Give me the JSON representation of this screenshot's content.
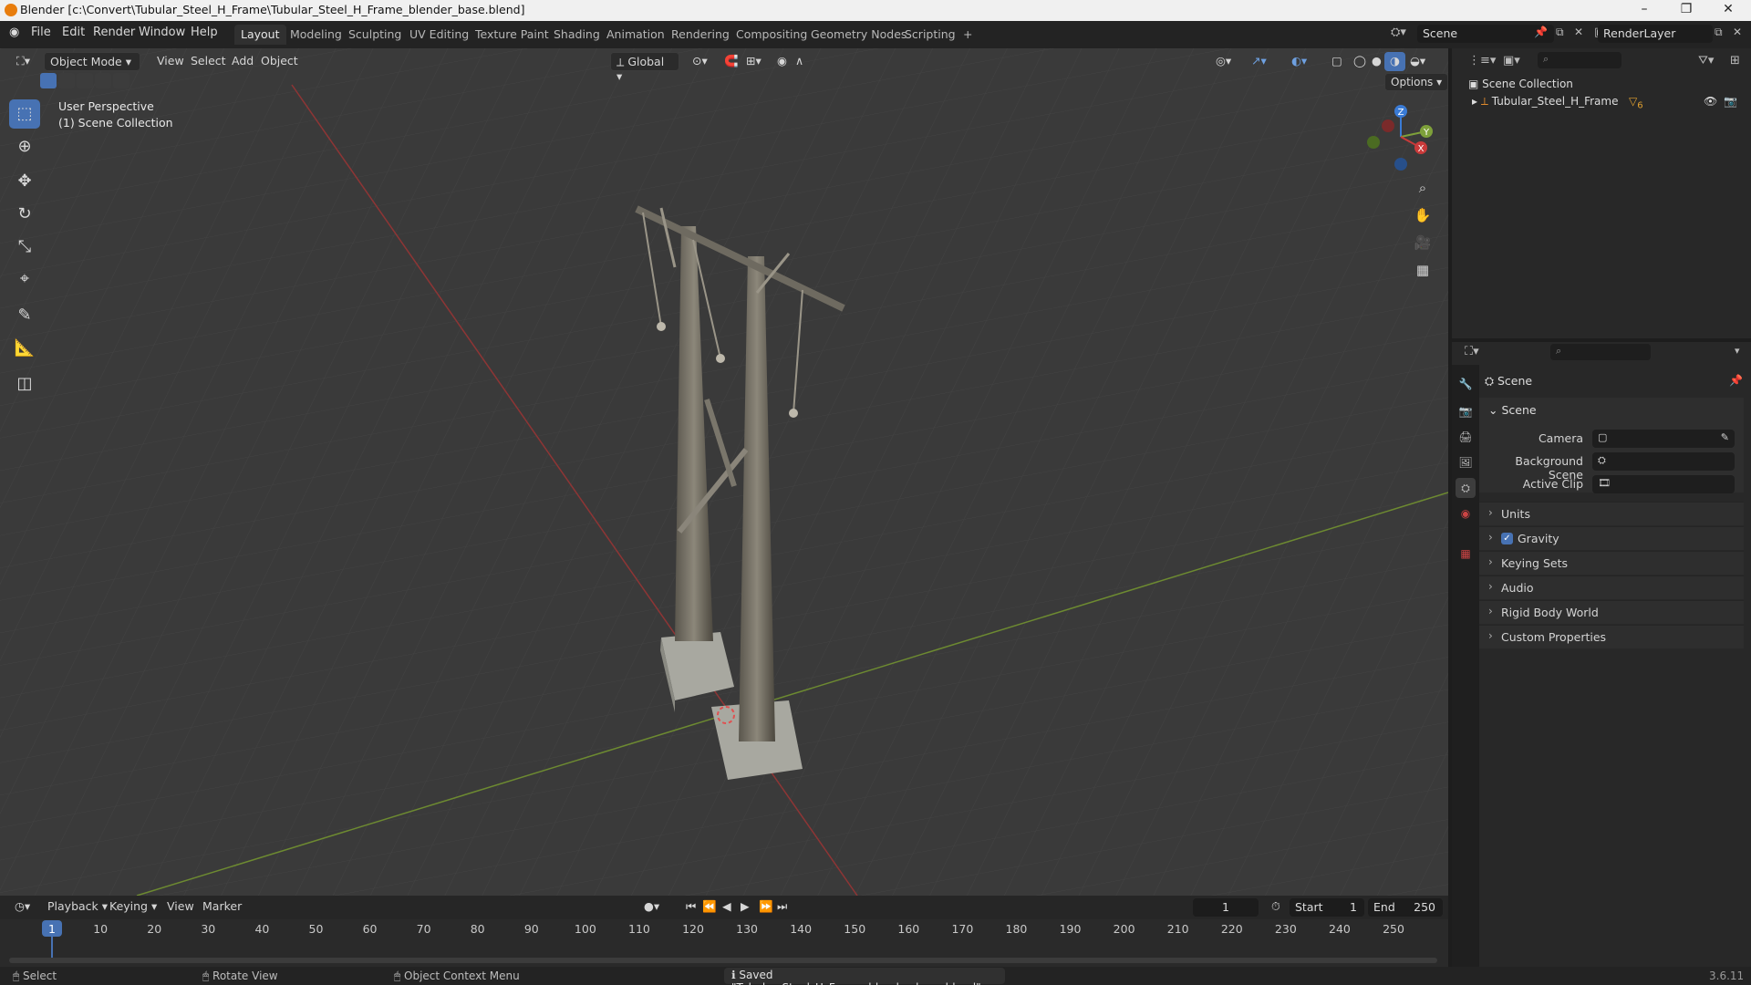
{
  "window": {
    "title": "Blender [c:\\Convert\\Tubular_Steel_H_Frame\\Tubular_Steel_H_Frame_blender_base.blend]"
  },
  "menus": [
    "File",
    "Edit",
    "Render",
    "Window",
    "Help"
  ],
  "workspaces": [
    "Layout",
    "Modeling",
    "Sculpting",
    "UV Editing",
    "Texture Paint",
    "Shading",
    "Animation",
    "Rendering",
    "Compositing",
    "Geometry Nodes",
    "Scripting",
    "+"
  ],
  "active_workspace": "Layout",
  "scene_field": "Scene",
  "renderlayer_field": "RenderLayer",
  "viewport": {
    "mode": "Object Mode",
    "menus": [
      "View",
      "Select",
      "Add",
      "Object"
    ],
    "orientation": "Global",
    "options_label": "Options",
    "overlay_line1": "User Perspective",
    "overlay_line2": "(1) Scene Collection",
    "gizmo": {
      "x": "X",
      "y": "Y",
      "z": "Z"
    }
  },
  "outliner": {
    "root": "Scene Collection",
    "items": [
      {
        "name": "Tubular_Steel_H_Frame",
        "badge": "6"
      }
    ]
  },
  "properties": {
    "header": "Scene",
    "panel": "Scene",
    "fields": [
      {
        "label": "Camera"
      },
      {
        "label": "Background Scene"
      },
      {
        "label": "Active Clip"
      }
    ],
    "subpanels": [
      "Units",
      "Gravity",
      "Keying Sets",
      "Audio",
      "Rigid Body World",
      "Custom Properties"
    ],
    "gravity_checked": true
  },
  "timeline": {
    "menus": [
      "Playback",
      "Keying",
      "View",
      "Marker"
    ],
    "current_frame": "1",
    "start_label": "Start",
    "start": "1",
    "end_label": "End",
    "end": "250",
    "ticks": [
      "1",
      "10",
      "20",
      "30",
      "40",
      "50",
      "60",
      "70",
      "80",
      "90",
      "100",
      "110",
      "120",
      "130",
      "140",
      "150",
      "160",
      "170",
      "180",
      "190",
      "200",
      "210",
      "220",
      "230",
      "240",
      "250"
    ]
  },
  "status": {
    "select": "Select",
    "rotate": "Rotate View",
    "context": "Object Context Menu",
    "message": "Saved \"Tubular_Steel_H_Frame_blender_base.blend\"",
    "version": "3.6.11"
  },
  "colors": {
    "accent": "#4772b3",
    "x_axis": "#c93a3a",
    "y_axis": "#7ea03a",
    "z_axis": "#3a7bd5",
    "viewport_bg": "#3a3a3a"
  }
}
